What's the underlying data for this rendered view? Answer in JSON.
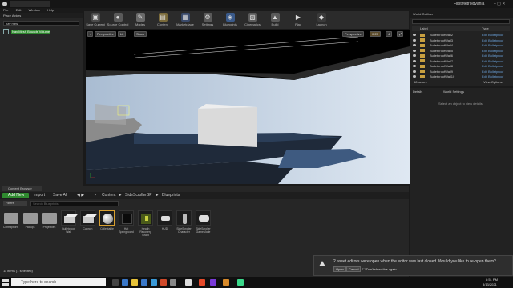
{
  "app": {
    "title": "FirstMetroidvania",
    "menu": [
      "File",
      "Edit",
      "Window",
      "Help"
    ]
  },
  "place_actors": {
    "header": "Place Actors",
    "search_value": "nav mes",
    "item_label": "Nav Mesh Bounds Volume"
  },
  "toolbar": [
    {
      "label": "Save Current",
      "icon": "save-icon",
      "color": "#4a4a4a"
    },
    {
      "label": "Source Control",
      "icon": "source-control-icon",
      "color": "#5a5a5a"
    },
    {
      "label": "Modes",
      "icon": "modes-icon",
      "color": "#6a6a6a"
    },
    {
      "label": "Content",
      "icon": "content-icon",
      "color": "#7a6a3a"
    },
    {
      "label": "Marketplace",
      "icon": "marketplace-icon",
      "color": "#3a4a6a"
    },
    {
      "label": "Settings",
      "icon": "settings-icon",
      "color": "#5a5a5a"
    },
    {
      "label": "Blueprints",
      "icon": "blueprints-icon",
      "color": "#3a5a8a"
    },
    {
      "label": "Cinematics",
      "icon": "cinematics-icon",
      "color": "#5a5a5a"
    },
    {
      "label": "Build",
      "icon": "build-icon",
      "color": "#5a5a5a"
    },
    {
      "label": "Play",
      "icon": "play-icon",
      "color": "#2b2b2b"
    },
    {
      "label": "Launch",
      "icon": "launch-icon",
      "color": "#3a3a3a"
    }
  ],
  "viewport": {
    "perspective": "Perspective",
    "lit": "Lit",
    "show": "Show",
    "right_mode": "Perspective",
    "snap_value": "0.25",
    "grid_value": "4"
  },
  "outliner": {
    "header": "World Outliner",
    "col_label": "Label",
    "col_type": "Type",
    "rows": [
      {
        "label": "BulletproofWall2",
        "type": "Edit Bulletproof"
      },
      {
        "label": "BulletproofWall3",
        "type": "Edit Bulletproof"
      },
      {
        "label": "BulletproofWall4",
        "type": "Edit Bulletproof"
      },
      {
        "label": "BulletproofWall5",
        "type": "Edit Bulletproof"
      },
      {
        "label": "BulletproofWall6",
        "type": "Edit Bulletproof"
      },
      {
        "label": "BulletproofWall7",
        "type": "Edit Bulletproof"
      },
      {
        "label": "BulletproofWall8",
        "type": "Edit Bulletproof"
      },
      {
        "label": "BulletproofWall9",
        "type": "Edit Bulletproof"
      },
      {
        "label": "BulletproofWall10",
        "type": "Edit Bulletproof"
      }
    ],
    "count": "58 actors",
    "view_options": "View Options"
  },
  "details": {
    "tab1": "Details",
    "tab2": "World Settings",
    "hint": "Select an object to view details."
  },
  "content_browser": {
    "tab": "Content Browser",
    "add_new": "Add New",
    "import": "Import",
    "save_all": "Save All",
    "path": [
      "Content",
      "SideScrollerBP",
      "Blueprints"
    ],
    "filters": "Filters",
    "search_placeholder": "Search Blueprints",
    "assets": [
      {
        "label": "Contraptions",
        "kind": "folder"
      },
      {
        "label": "Pickups",
        "kind": "folder"
      },
      {
        "label": "Projectiles",
        "kind": "folder"
      },
      {
        "label": "Bulletproof Wall",
        "kind": "cube"
      },
      {
        "label": "Cannon",
        "kind": "cube"
      },
      {
        "label": "Collectable",
        "kind": "sphere"
      },
      {
        "label": "Hat Springboard",
        "kind": "dark"
      },
      {
        "label": "Health Recovery Grant",
        "kind": "green"
      },
      {
        "label": "HUD",
        "kind": "hud"
      },
      {
        "label": "SideScroller Character",
        "kind": "char"
      },
      {
        "label": "SideScroller GameMode",
        "kind": "gamemode"
      }
    ],
    "footer": "11 items (1 selected)"
  },
  "notification": {
    "message": "2 asset editors were open when the editor was last closed. Would you like to re-open them?",
    "open": "Open",
    "cancel": "Cancel",
    "dont_show": "Don't show this again"
  },
  "taskbar": {
    "search_placeholder": "Type here to search",
    "time": "8:51 PM",
    "date": "8/13/2021"
  }
}
